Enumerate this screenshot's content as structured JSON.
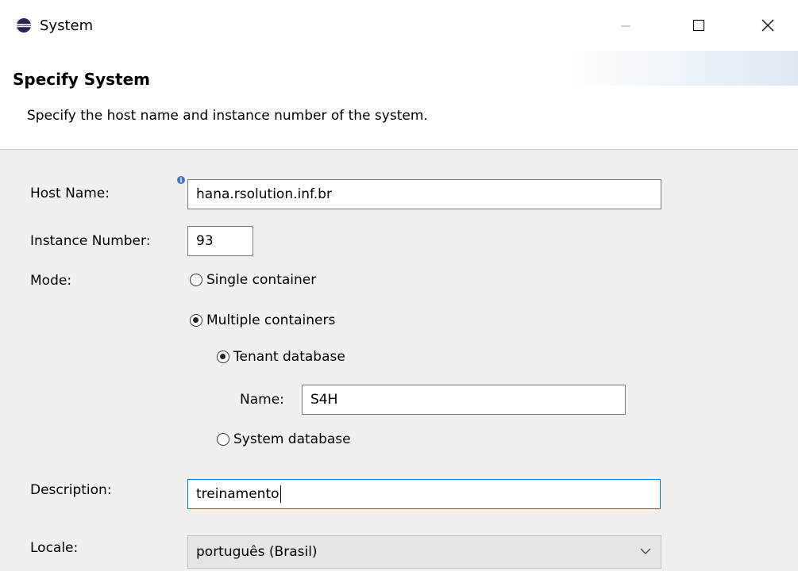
{
  "window": {
    "title": "System",
    "controls": {
      "minimize": "—",
      "maximize": "☐",
      "close": "✕"
    }
  },
  "banner": {
    "title": "Specify System",
    "description": "Specify the host name and instance number of the system."
  },
  "form": {
    "host_name_label": "Host Name:",
    "host_name_value": "hana.rsolution.inf.br",
    "instance_number_label": "Instance Number:",
    "instance_number_value": "93",
    "mode_label": "Mode:",
    "mode_single": "Single container",
    "mode_multiple": "Multiple containers",
    "tenant_database": "Tenant database",
    "name_label": "Name:",
    "name_value": "S4H",
    "system_database": "System database",
    "description_label": "Description:",
    "description_value": "treinamento",
    "locale_label": "Locale:",
    "locale_value": "português (Brasil)"
  },
  "state": {
    "mode": "multiple",
    "container": "tenant"
  },
  "colors": {
    "content_bg": "#f0f0f0",
    "focus_border": "#0078d7",
    "info_icon": "#3d78c8"
  }
}
